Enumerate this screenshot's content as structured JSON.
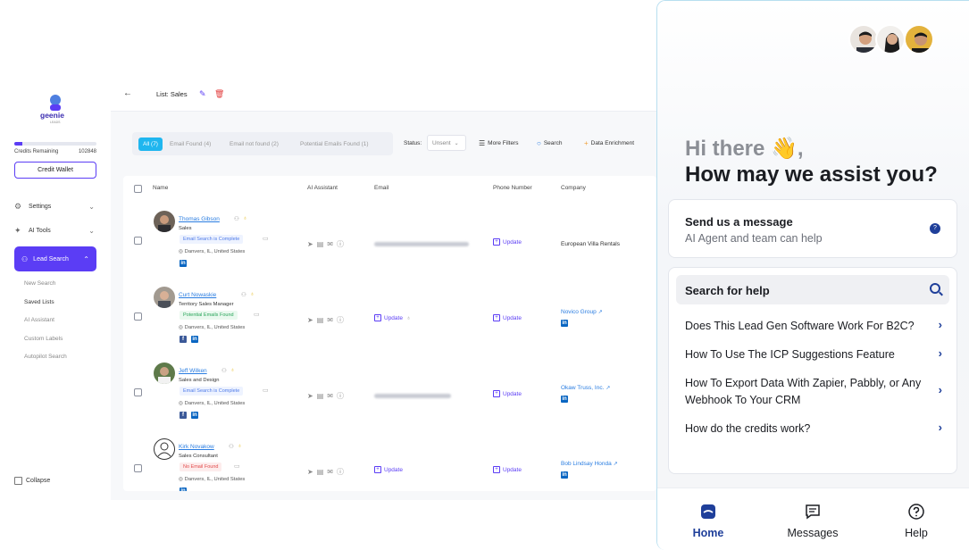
{
  "sidebar": {
    "logo_text": "geenie",
    "logo_sub": "LEADS",
    "credits_label": "Credits Remaining",
    "credits_value": "102848",
    "credits_fill_pct": 10,
    "credit_wallet": "Credit Wallet",
    "settings": "Settings",
    "ai_tools": "AI Tools",
    "lead_search": "Lead Search",
    "sub_items": [
      "New Search",
      "Saved Lists",
      "AI Assistant",
      "Custom Labels",
      "Autopilot Search"
    ],
    "collapse": "Collapse"
  },
  "topbar": {
    "list_title": "List: Sales"
  },
  "filters": {
    "chips": [
      "All (7)",
      "Email Found (4)",
      "Email not found (2)",
      "Potential Emails Found (1)"
    ],
    "status_label": "Status:",
    "status_value": "Unsent",
    "more_filters": "More Filters",
    "search": "Search",
    "data_enrichment": "Data Enrichment"
  },
  "table": {
    "headers": [
      "Name",
      "AI Assistant",
      "Email",
      "Phone Number",
      "Company"
    ],
    "rows": [
      {
        "name": "Thomas Gibson",
        "title": "Sales",
        "badge": "Email Search is Complete",
        "location": "Danvers, IL, United States",
        "email_update": "",
        "phone_update": "Update",
        "company": "European Villa Rentals"
      },
      {
        "name": "Curt Nowaskie",
        "title": "Territory Sales Manager",
        "badge": "Potential Emails Found",
        "location": "Danvers, IL, United States",
        "email_update": "Update",
        "phone_update": "Update",
        "company": "Novico Group"
      },
      {
        "name": "Jeff Wilken",
        "title": "Sales and Design",
        "badge": "Email Search is Complete",
        "location": "Danvers, IL, United States",
        "email_update": "",
        "phone_update": "Update",
        "company": "Okaw Truss, Inc."
      },
      {
        "name": "Kirk Novakow",
        "title": "Sales Consultant",
        "badge": "No Email Found",
        "location": "Danvers, IL, United States",
        "email_update": "Update",
        "phone_update": "Update",
        "company": "Bob Lindsay Honda"
      }
    ]
  },
  "widget": {
    "greeting_line1": "Hi there 👋,",
    "greeting_line2": "How may we assist you?",
    "send_title": "Send us a message",
    "send_sub": "AI Agent and team can help",
    "search_label": "Search for help",
    "help_items": [
      "Does This Lead Gen Software Work For B2C?",
      "How To Use The ICP Suggestions Feature",
      "How To Export Data With Zapier, Pabbly, or Any Webhook To Your CRM",
      "How do the credits work?"
    ],
    "nav": [
      "Home",
      "Messages",
      "Help"
    ]
  },
  "colors": {
    "accent": "#5b3df5",
    "link": "#2a7de1",
    "chip": "#1fb6ef",
    "widget_accent": "#1f3f9a"
  }
}
